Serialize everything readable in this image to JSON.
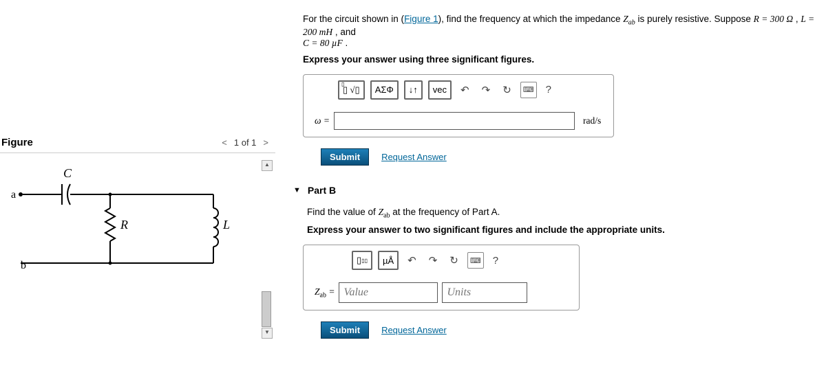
{
  "figure": {
    "title": "Figure",
    "nav_label": "1 of 1",
    "labels": {
      "a": "a",
      "b": "b",
      "C": "C",
      "R": "R",
      "L": "L"
    }
  },
  "partA": {
    "prompt_pre": "For the circuit shown in (",
    "figure_link": "Figure 1",
    "prompt_post": "), find the frequency at which the impedance ",
    "zab": "Z",
    "zab_sub": "ab",
    "prompt_tail": " is purely resistive. Suppose ",
    "R_expr": "R = 300 Ω",
    "L_expr": "L = 200 mH",
    "and": " , and ",
    "C_expr": "C = 80 µF",
    "instr": "Express your answer using three significant figures.",
    "omega": "ω =",
    "units": "rad/s",
    "toolbar": {
      "sigma": "ΑΣΦ",
      "vec": "vec",
      "help": "?"
    },
    "submit": "Submit",
    "request": "Request Answer"
  },
  "partB": {
    "title": "Part B",
    "prompt1": "Find the value of ",
    "zab": "Z",
    "zab_sub": "ab",
    "prompt2": " at the frequency of Part A.",
    "instr": "Express your answer to two significant figures and include the appropriate units.",
    "toolbar": {
      "uA": "µÅ",
      "help": "?"
    },
    "label": "Z",
    "label_sub": "ab",
    "eq": " =",
    "value_ph": "Value",
    "units_ph": "Units",
    "submit": "Submit",
    "request": "Request Answer"
  }
}
